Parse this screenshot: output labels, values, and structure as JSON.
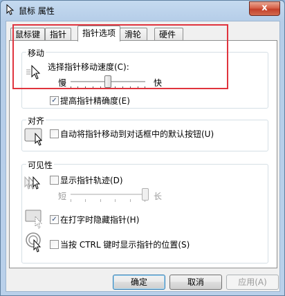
{
  "window": {
    "title": "鼠标 属性",
    "close_glyph": "x"
  },
  "tabs": [
    {
      "label": "鼠标键"
    },
    {
      "label": "指针"
    },
    {
      "label": "指针选项"
    },
    {
      "label": "滑轮"
    },
    {
      "label": "硬件"
    }
  ],
  "motion": {
    "title": "移动",
    "speed_label": "选择指针移动速度(C):",
    "slow_label": "慢",
    "fast_label": "快",
    "speed_level": 0.5,
    "precision_label": "提高指针精确度(E)",
    "precision_checked": true
  },
  "snap": {
    "title": "对齐",
    "snap_label": "自动将指针移动到对话框中的默认按钮(U)",
    "snap_checked": false
  },
  "visibility": {
    "title": "可见性",
    "trails_label": "显示指针轨迹(D)",
    "trails_checked": false,
    "short_label": "短",
    "long_label": "长",
    "trail_level": 1.0,
    "hide_label": "在打字时隐藏指针(H)",
    "hide_checked": true,
    "ctrl_label": "当按 CTRL 键时显示指针的位置(S)",
    "ctrl_checked": false
  },
  "buttons": {
    "ok": "确定",
    "cancel": "取消",
    "apply": "应用(A)"
  },
  "check_glyph": "✓",
  "colors": {
    "highlight": "#e0333d",
    "title_bar": "#b9d0ea",
    "close_button": "#c3402a"
  }
}
